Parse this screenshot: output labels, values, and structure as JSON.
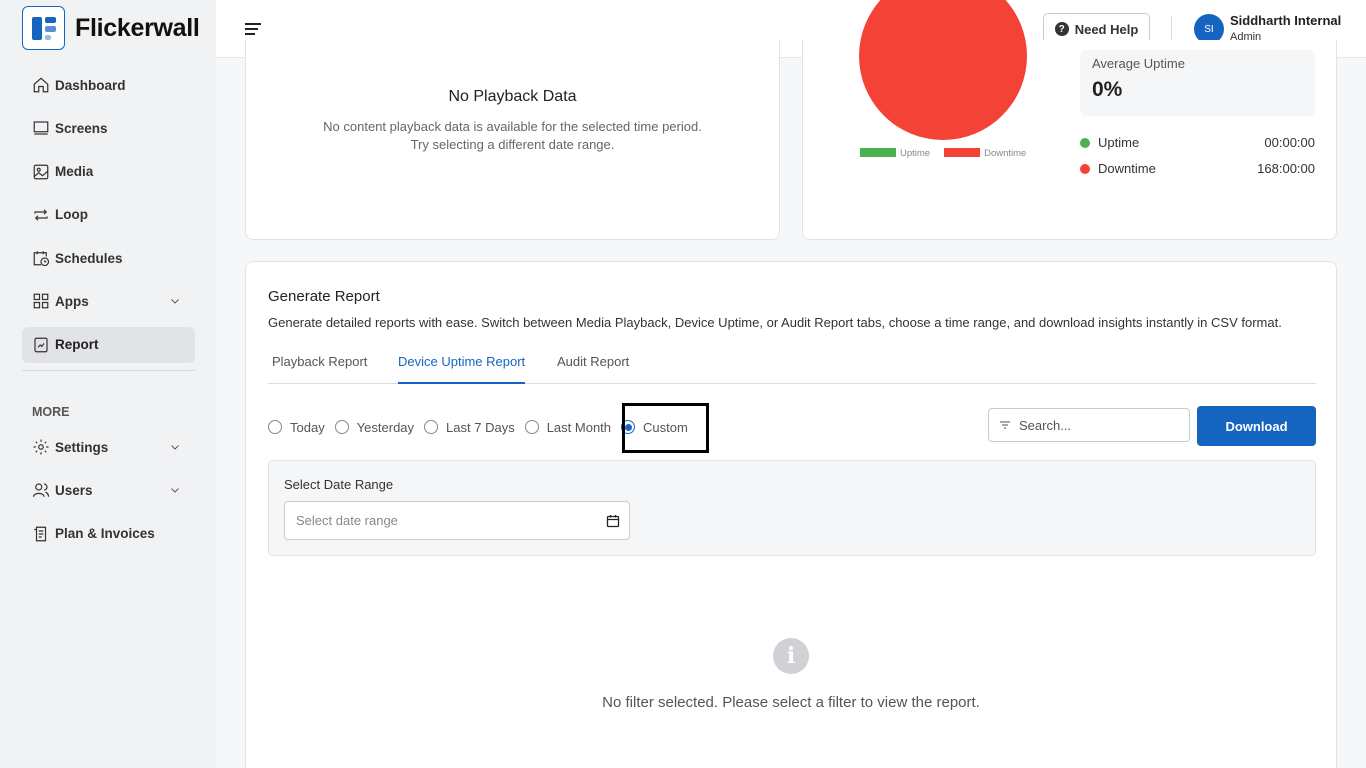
{
  "brand": {
    "name": "Flickerwall"
  },
  "sidebar": {
    "items": [
      {
        "label": "Dashboard",
        "icon": "home-icon"
      },
      {
        "label": "Screens",
        "icon": "screen-icon"
      },
      {
        "label": "Media",
        "icon": "image-icon"
      },
      {
        "label": "Loop",
        "icon": "loop-icon"
      },
      {
        "label": "Schedules",
        "icon": "calendar-clock-icon"
      },
      {
        "label": "Apps",
        "icon": "grid-icon"
      },
      {
        "label": "Report",
        "icon": "report-icon",
        "active": true
      }
    ],
    "more_label": "MORE",
    "more_items": [
      {
        "label": "Settings",
        "icon": "gear-icon"
      },
      {
        "label": "Users",
        "icon": "users-icon"
      },
      {
        "label": "Plan & Invoices",
        "icon": "invoice-icon"
      }
    ]
  },
  "header": {
    "help_label": "Need Help",
    "user": {
      "initials": "SI",
      "name": "Siddharth Internal",
      "role": "Admin"
    }
  },
  "playback_card": {
    "title": "No Playback Data",
    "desc_line1": "No content playback data is available for the selected time period.",
    "desc_line2": "Try selecting a different date range."
  },
  "uptime_card": {
    "legend": [
      "Uptime",
      "Downtime"
    ],
    "avg_label": "Average Uptime",
    "avg_value": "0%",
    "uptime_label": "Uptime",
    "uptime_value": "00:00:00",
    "downtime_label": "Downtime",
    "downtime_value": "168:00:00",
    "colors": {
      "uptime": "#4caf50",
      "downtime": "#f44336"
    }
  },
  "chart_data": {
    "type": "pie",
    "categories": [
      "Uptime",
      "Downtime"
    ],
    "values": [
      0,
      168
    ],
    "legend_position": "bottom"
  },
  "report": {
    "title": "Generate Report",
    "desc": "Generate detailed reports with ease. Switch between Media Playback, Device Uptime, or Audit Report tabs, choose a time range, and download insights instantly in CSV format.",
    "tabs": [
      "Playback Report",
      "Device Uptime Report",
      "Audit Report"
    ],
    "active_tab": 1,
    "ranges": [
      "Today",
      "Yesterday",
      "Last 7 Days",
      "Last Month",
      "Custom"
    ],
    "selected_range": "Custom",
    "search_placeholder": "Search...",
    "download_label": "Download",
    "date_range_label": "Select Date Range",
    "date_range_placeholder": "Select date range",
    "empty_message": "No filter selected. Please select a filter to view the report."
  }
}
